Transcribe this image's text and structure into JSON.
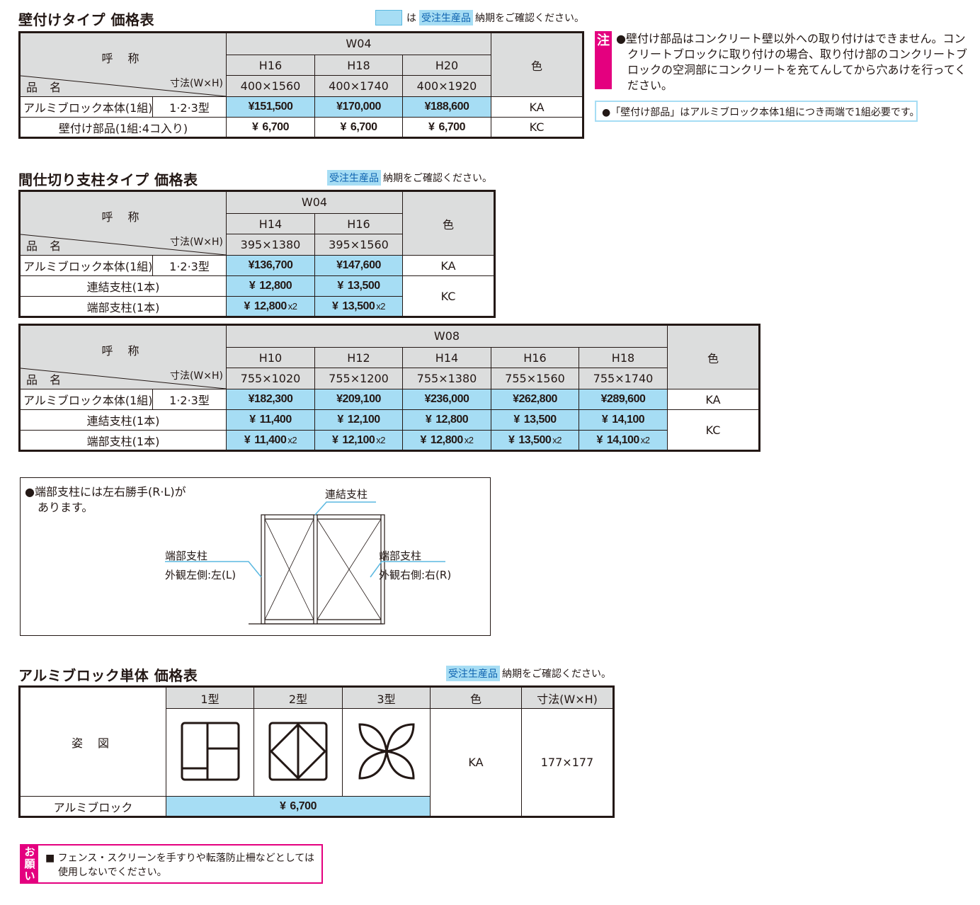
{
  "legend": {
    "is_label": "は",
    "badge": "受注生産品",
    "delivery_note": "納期をご確認ください。"
  },
  "wall": {
    "title": "壁付けタイプ 価格表",
    "header": {
      "call_name": "呼 称",
      "dim_label": "寸法(W×H)",
      "product_name": "品 名",
      "width_code": "W04",
      "color": "色"
    },
    "heights": [
      "H16",
      "H18",
      "H20"
    ],
    "dims": [
      "400×1560",
      "400×1740",
      "400×1920"
    ],
    "rows": [
      {
        "name": "アルミブロック本体(1組)",
        "type": "1·2·3型",
        "prices": [
          "151,500",
          "170,000",
          "188,600"
        ],
        "color": "KA"
      },
      {
        "name": "壁付け部品(1組:4コ入り)",
        "prices": [
          "6,700",
          "6,700",
          "6,700"
        ],
        "color": "KC"
      }
    ],
    "note_mark": "注",
    "note_lines": [
      "●壁付け部品はコンクリート壁以外への取り付けはできません。コン",
      "クリートブロックに取り付けの場合、取り付け部のコンクリートブ",
      "ロックの空洞部にコンクリートを充てんしてから穴あけを行ってく",
      "ださい。"
    ],
    "note2": "●「壁付け部品」はアルミブロック本体1組につき両端で1組必要です。"
  },
  "post": {
    "title": "間仕切り支柱タイプ 価格表",
    "header": {
      "call_name": "呼 称",
      "dim_label": "寸法(W×H)",
      "product_name": "品 名",
      "color": "色"
    },
    "w04": {
      "width_code": "W04",
      "heights": [
        "H14",
        "H16"
      ],
      "dims": [
        "395×1380",
        "395×1560"
      ],
      "rows": [
        {
          "name": "アルミブロック本体(1組)",
          "type": "1·2·3型",
          "prices": [
            "136,700",
            "147,600"
          ],
          "color": "KA"
        },
        {
          "name": "連結支柱(1本)",
          "prices": [
            "12,800",
            "13,500"
          ],
          "color": "KC"
        },
        {
          "name": "端部支柱(1本)",
          "prices": [
            "12,800",
            "13,500"
          ],
          "mult": "x2"
        }
      ]
    },
    "w08": {
      "width_code": "W08",
      "heights": [
        "H10",
        "H12",
        "H14",
        "H16",
        "H18"
      ],
      "dims": [
        "755×1020",
        "755×1200",
        "755×1380",
        "755×1560",
        "755×1740"
      ],
      "rows": [
        {
          "name": "アルミブロック本体(1組)",
          "type": "1·2·3型",
          "prices": [
            "182,300",
            "209,100",
            "236,000",
            "262,800",
            "289,600"
          ],
          "color": "KA"
        },
        {
          "name": "連結支柱(1本)",
          "prices": [
            "11,400",
            "12,100",
            "12,800",
            "13,500",
            "14,100"
          ],
          "color": "KC"
        },
        {
          "name": "端部支柱(1本)",
          "prices": [
            "11,400",
            "12,100",
            "12,800",
            "13,500",
            "14,100"
          ],
          "mult": "x2"
        }
      ]
    }
  },
  "figure": {
    "note_line1": "●端部支柱には左右勝手(R·L)が",
    "note_line2": "あります。",
    "connect_post": "連結支柱",
    "left_post": "端部支柱",
    "left_side": "外観左側:左(L)",
    "right_post": "端部支柱",
    "right_side": "外観右側:右(R)"
  },
  "unit": {
    "title": "アルミブロック単体 価格表",
    "header": {
      "shape": "姿 図",
      "type1": "1型",
      "type2": "2型",
      "type3": "3型",
      "color": "色",
      "dim": "寸法(W×H)"
    },
    "color": "KA",
    "dim": "177×177",
    "row_name": "アルミブロック",
    "price": "6,700"
  },
  "request": {
    "mark": "お願い",
    "line1": "■ フェンス・スクリーンを手すりや転落防止柵などとしては",
    "line2": "使用しないでください。"
  },
  "currency": "¥",
  "colors": {
    "order_blue": "#a6ddf4",
    "header_gray": "#dcdddd",
    "accent_pink": "#e4007f"
  }
}
